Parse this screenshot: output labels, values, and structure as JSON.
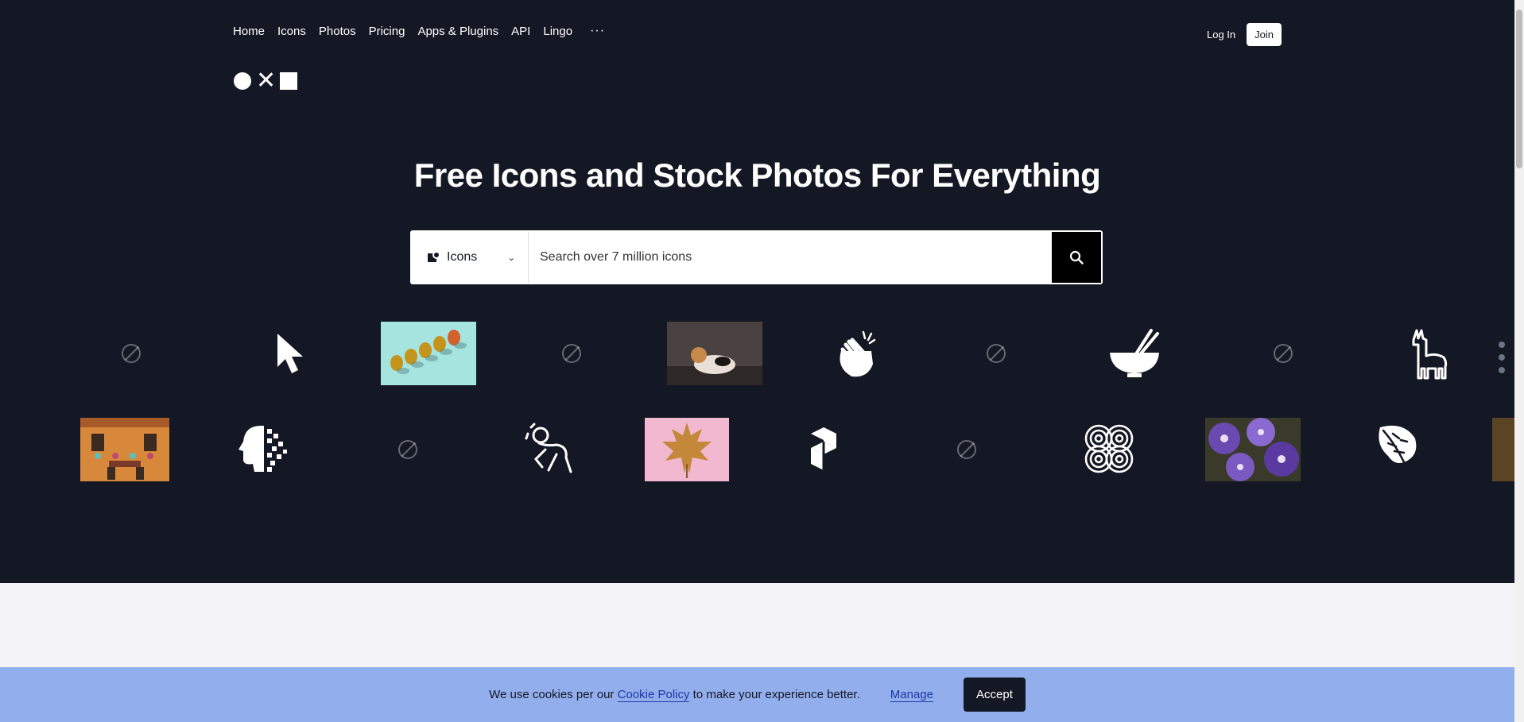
{
  "nav": {
    "items": [
      {
        "label": "Home"
      },
      {
        "label": "Icons"
      },
      {
        "label": "Photos"
      },
      {
        "label": "Pricing"
      },
      {
        "label": "Apps & Plugins"
      },
      {
        "label": "API"
      },
      {
        "label": "Lingo"
      }
    ],
    "more_label": "···",
    "login_label": "Log In",
    "join_label": "Join"
  },
  "hero": {
    "headline": "Free Icons and Stock Photos For Everything"
  },
  "search": {
    "type_label": "Icons",
    "placeholder": "Search over 7 million icons"
  },
  "cookie_banner": {
    "text_before": "We use cookies per our ",
    "policy_link": "Cookie Policy",
    "text_after": " to make your experience better.",
    "manage_label": "Manage",
    "accept_label": "Accept"
  },
  "colors": {
    "hero_bg": "#141824",
    "banner_bg": "#92aeec",
    "link": "#1b3aa7"
  },
  "gallery": {
    "row1": [
      {
        "kind": "blocked-photo",
        "colors": [
          "#c4281c",
          "#b52e1c",
          "#d45a2a",
          "#a87a14",
          "#b39a30",
          "#c4a93a",
          "#0b2a38",
          "#c4bba7",
          "#5a9aa4"
        ]
      },
      {
        "kind": "icon",
        "icon": "cursor-arrow-icon"
      },
      {
        "kind": "photo",
        "subject": "pears"
      },
      {
        "kind": "blocked-photo",
        "colors": [
          "#2a2d3a",
          "#525564",
          "#2e3140",
          "#3a3d4c",
          "#6a6c78",
          "#3a3d4c",
          "#1e2130",
          "#3a3d4c",
          "#1e2130"
        ]
      },
      {
        "kind": "photo",
        "subject": "cat"
      },
      {
        "kind": "icon",
        "icon": "clapping-hands-icon"
      },
      {
        "kind": "blocked-photo",
        "colors": [
          "#455866",
          "#564a50",
          "#3e6055",
          "#8a3a3a",
          "#c44a4e",
          "#7e908a",
          "#a4604a",
          "#9a3444",
          "#b4848a"
        ]
      },
      {
        "kind": "icon",
        "icon": "bowl-chopsticks-icon"
      },
      {
        "kind": "blocked-photo",
        "colors": [
          "#8a8a7a",
          "#8a6a48",
          "#2a1e10",
          "#3a3a2a",
          "#6a5a3a",
          "#2a2618",
          "#2a4040",
          "#6a6848",
          "#2a2e28"
        ]
      },
      {
        "kind": "icon",
        "icon": "llama-icon"
      }
    ],
    "row2": [
      {
        "kind": "photo",
        "subject": "building-facade"
      },
      {
        "kind": "icon",
        "icon": "pixel-head-icon"
      },
      {
        "kind": "blocked-photo",
        "colors": [
          "#c4ccd0",
          "#e2e6e8",
          "#d4cec8",
          "#c0a898",
          "#b8a494",
          "#fdf6ec",
          "#9a9888",
          "#c8b49a",
          "#e0c8a4"
        ]
      },
      {
        "kind": "icon",
        "icon": "crouching-figure-icon"
      },
      {
        "kind": "photo",
        "subject": "autumn-leaf"
      },
      {
        "kind": "icon",
        "icon": "cube-steps-icon"
      },
      {
        "kind": "blocked-photo",
        "colors": [
          "#3a2a22",
          "#a89490",
          "#2a1e18",
          "#241c18",
          "#5a4a46",
          "#6a5a50",
          "#0e0c0a",
          "#4a3a34",
          "#746658"
        ]
      },
      {
        "kind": "icon",
        "icon": "spiral-pattern-icon"
      },
      {
        "kind": "photo",
        "subject": "purple-flowers"
      },
      {
        "kind": "icon",
        "icon": "monstera-leaf-icon"
      }
    ]
  }
}
